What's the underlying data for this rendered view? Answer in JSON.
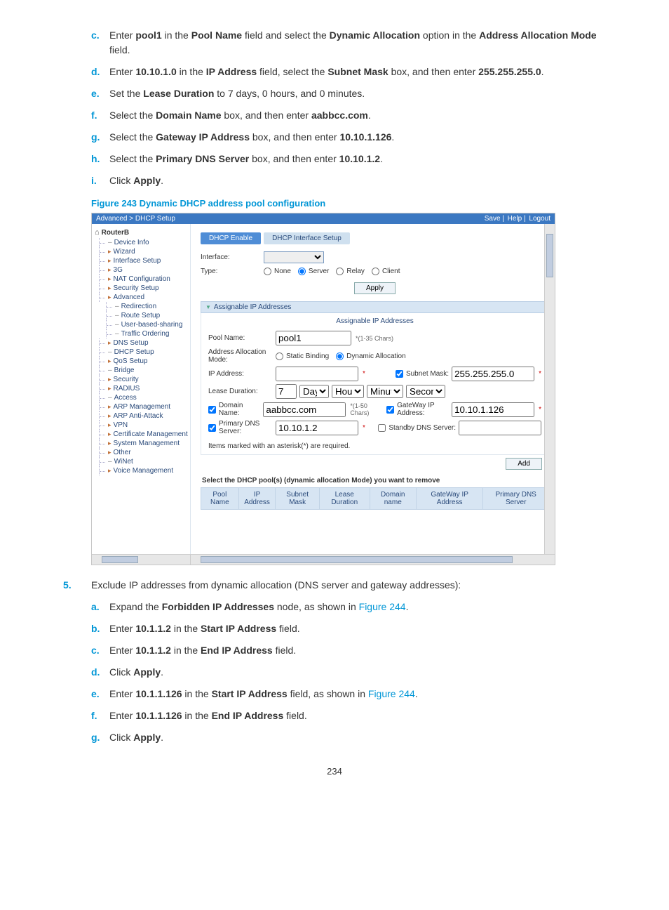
{
  "steps_top": [
    {
      "marker": "c.",
      "html": "Enter <b>pool1</b> in the <b>Pool Name</b> field and select the <b>Dynamic Allocation</b> option in the <b>Address Allocation Mode</b> field."
    },
    {
      "marker": "d.",
      "html": "Enter <b>10.10.1.0</b> in the <b>IP Address</b> field, select the <b>Subnet Mask</b> box, and then enter <b>255.255.255.0</b>."
    },
    {
      "marker": "e.",
      "html": "Set the <b>Lease Duration</b> to 7 days, 0 hours, and 0 minutes."
    },
    {
      "marker": "f.",
      "html": "Select the <b>Domain Name</b> box, and then enter <b>aabbcc.com</b>."
    },
    {
      "marker": "g.",
      "html": "Select the <b>Gateway IP Address</b> box, and then enter <b>10.10.1.126</b>."
    },
    {
      "marker": "h.",
      "html": "Select the <b>Primary DNS Server</b> box, and then enter <b>10.10.1.2</b>."
    },
    {
      "marker": "i.",
      "html": "Click <b>Apply</b>."
    }
  ],
  "figure_caption": "Figure 243 Dynamic DHCP address pool configuration",
  "screenshot": {
    "breadcrumb": "Advanced > DHCP Setup",
    "top_links": [
      "Save",
      "Help",
      "Logout"
    ],
    "device_name": "RouterB",
    "nav": [
      {
        "label": "Device Info",
        "type": "leaf"
      },
      {
        "label": "Wizard",
        "type": "folder"
      },
      {
        "label": "Interface Setup",
        "type": "folder"
      },
      {
        "label": "3G",
        "type": "folder"
      },
      {
        "label": "NAT Configuration",
        "type": "folder"
      },
      {
        "label": "Security Setup",
        "type": "folder"
      },
      {
        "label": "Advanced",
        "type": "folder",
        "children": [
          {
            "label": "Redirection"
          },
          {
            "label": "Route Setup"
          },
          {
            "label": "User-based-sharing"
          },
          {
            "label": "Traffic Ordering"
          }
        ]
      },
      {
        "label": "DNS Setup",
        "type": "folder"
      },
      {
        "label": "DHCP Setup",
        "type": "leaf"
      },
      {
        "label": "QoS Setup",
        "type": "folder"
      },
      {
        "label": "Bridge",
        "type": "leaf"
      },
      {
        "label": "Security",
        "type": "folder"
      },
      {
        "label": "RADIUS",
        "type": "folder"
      },
      {
        "label": "Access",
        "type": "leaf"
      },
      {
        "label": "ARP Management",
        "type": "folder"
      },
      {
        "label": "ARP Anti-Attack",
        "type": "folder"
      },
      {
        "label": "VPN",
        "type": "folder"
      },
      {
        "label": "Certificate Management",
        "type": "folder"
      },
      {
        "label": "System Management",
        "type": "folder"
      },
      {
        "label": "Other",
        "type": "folder"
      },
      {
        "label": "WiNet",
        "type": "leaf"
      },
      {
        "label": "Voice Management",
        "type": "folder"
      }
    ],
    "tabs": {
      "active": "DHCP Enable",
      "inactive": "DHCP Interface Setup"
    },
    "form": {
      "interface_label": "Interface:",
      "type_label": "Type:",
      "type_options": [
        "None",
        "Server",
        "Relay",
        "Client"
      ],
      "type_selected": "Server",
      "apply_btn": "Apply"
    },
    "section_header": "Assignable IP Addresses",
    "panel": {
      "title": "Assignable IP Addresses",
      "pool_name_label": "Pool Name:",
      "pool_name_value": "pool1",
      "pool_name_hint": "*(1-35 Chars)",
      "alloc_label": "Address Allocation Mode:",
      "alloc_options": [
        "Static Binding",
        "Dynamic Allocation"
      ],
      "alloc_selected": "Dynamic Allocation",
      "ip_label": "IP Address:",
      "ip_value": "",
      "subnet_label": "Subnet Mask:",
      "subnet_value": "255.255.255.0",
      "lease_label": "Lease Duration:",
      "lease_day": "7",
      "lease_units": [
        "Day",
        "Hour",
        "Minute",
        "Second"
      ],
      "domain_label": "Domain Name:",
      "domain_value": "aabbcc.com",
      "domain_hint": "*(1-50 Chars)",
      "gateway_label": "GateWay IP Address:",
      "gateway_value": "10.10.1.126",
      "dns_label": "Primary DNS Server:",
      "dns_value": "10.10.1.2",
      "standby_label": "Standby DNS Server:",
      "required_note": "Items marked with an asterisk(*) are required.",
      "add_btn": "Add"
    },
    "remove_note": "Select the DHCP pool(s) (dynamic allocation Mode) you want to remove",
    "table_headers": [
      "Pool Name",
      "IP Address",
      "Subnet Mask",
      "Lease Duration",
      "Domain name",
      "GateWay IP Address",
      "Primary DNS Server"
    ]
  },
  "step5": {
    "marker": "5.",
    "text": "Exclude IP addresses from dynamic allocation (DNS server and gateway addresses):",
    "sub": [
      {
        "marker": "a.",
        "html": "Expand the <b>Forbidden IP Addresses</b> node, as shown in <span class='link'>Figure 244</span>."
      },
      {
        "marker": "b.",
        "html": "Enter <b>10.1.1.2</b> in the <b>Start IP Address</b> field."
      },
      {
        "marker": "c.",
        "html": "Enter <b>10.1.1.2</b> in the <b>End IP Address</b> field."
      },
      {
        "marker": "d.",
        "html": "Click <b>Apply</b>."
      },
      {
        "marker": "e.",
        "html": "Enter <b>10.1.1.126</b> in the <b>Start IP Address</b> field, as shown in <span class='link'>Figure 244</span>."
      },
      {
        "marker": "f.",
        "html": "Enter <b>10.1.1.126</b> in the <b>End IP Address</b> field."
      },
      {
        "marker": "g.",
        "html": "Click <b>Apply</b>."
      }
    ]
  },
  "page_number": "234"
}
